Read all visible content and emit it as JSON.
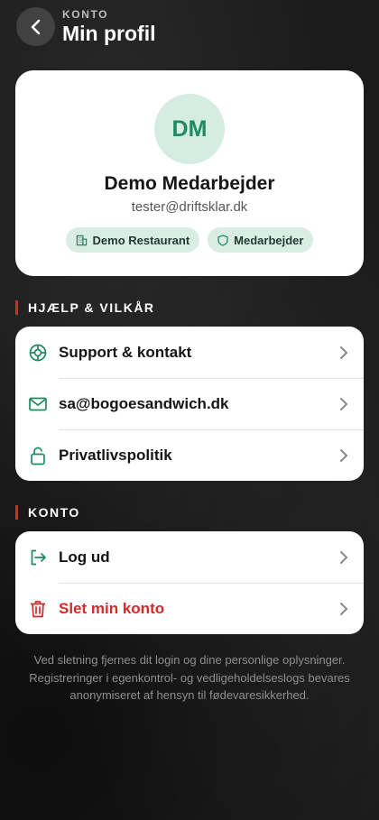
{
  "header": {
    "eyebrow": "KONTO",
    "title": "Min profil",
    "back_icon": "chevron-left-icon"
  },
  "profile": {
    "initials": "DM",
    "name": "Demo Medarbejder",
    "email": "tester@driftsklar.dk",
    "badges": [
      {
        "label": "Demo Restaurant",
        "icon": "building-icon"
      },
      {
        "label": "Medarbejder",
        "icon": "shield-icon"
      }
    ]
  },
  "help_section": {
    "label": "HJÆLP & VILKÅR",
    "items": [
      {
        "label": "Support & kontakt",
        "icon": "lifebuoy-icon"
      },
      {
        "label": "sa@bogoesandwich.dk",
        "icon": "mail-icon"
      },
      {
        "label": "Privatlivspolitik",
        "icon": "lock-icon"
      }
    ]
  },
  "account_section": {
    "label": "KONTO",
    "items": [
      {
        "label": "Log ud",
        "icon": "logout-icon"
      },
      {
        "label": "Slet min konto",
        "icon": "trash-icon"
      }
    ]
  },
  "footnote": "Ved sletning fjernes dit login og dine personlige oplysninger. Registreringer i egenkontrol- og vedligeholdelseslogs bevares anonymiseret af hensyn til fødevaresikkerhed.",
  "colors": {
    "accent_green": "#1e8a60",
    "danger_red": "#d42a2a",
    "section_marker": "#d62b2b"
  }
}
